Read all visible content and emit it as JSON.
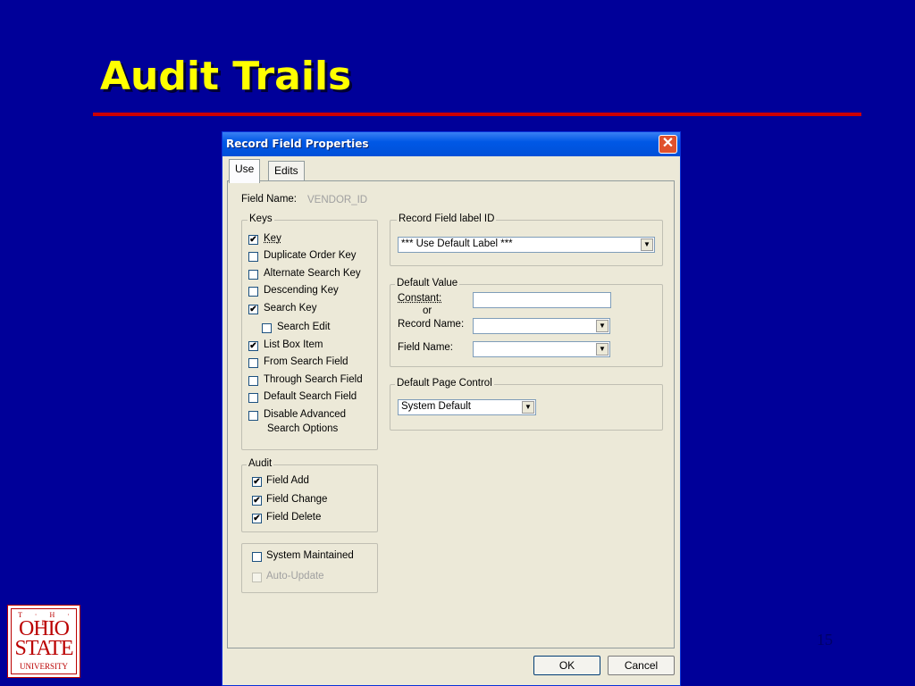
{
  "slide": {
    "title": "Audit Trails",
    "page_number": "15",
    "logo": {
      "the": "T · H · E",
      "line1": "OHIO",
      "line2": "STATE",
      "line3": "UNIVERSITY"
    }
  },
  "dialog": {
    "title": "Record Field Properties",
    "close_glyph": "✕",
    "tabs": [
      "Use",
      "Edits"
    ],
    "active_tab": "Use",
    "field_name_label": "Field Name:",
    "field_name_value": "VENDOR_ID",
    "keys": {
      "title": "Keys",
      "items": [
        {
          "label": "Key",
          "checked": true
        },
        {
          "label": "Duplicate Order Key",
          "checked": false
        },
        {
          "label": "Alternate Search Key",
          "checked": false
        },
        {
          "label": "Descending Key",
          "checked": false
        },
        {
          "label": "Search Key",
          "checked": true
        },
        {
          "label": "Search Edit",
          "checked": false
        },
        {
          "label": "List Box Item",
          "checked": true
        },
        {
          "label": "From Search Field",
          "checked": false
        },
        {
          "label": "Through Search Field",
          "checked": false
        },
        {
          "label": "Default Search Field",
          "checked": false
        },
        {
          "label": "Disable Advanced",
          "checked": false
        }
      ],
      "disable_advanced_line2": "Search Options"
    },
    "audit": {
      "title": "Audit",
      "items": [
        {
          "label": "Field Add",
          "checked": true
        },
        {
          "label": "Field Change",
          "checked": true
        },
        {
          "label": "Field Delete",
          "checked": true
        }
      ]
    },
    "system": {
      "system_maintained": "System Maintained",
      "auto_update": "Auto-Update"
    },
    "record_field_label": {
      "title": "Record Field label ID",
      "value": "*** Use Default Label ***"
    },
    "default_value": {
      "title": "Default Value",
      "constant_label": "Constant:",
      "or_label": "or",
      "record_name_label": "Record Name:",
      "field_name_label": "Field Name:"
    },
    "default_page_control": {
      "title": "Default Page Control",
      "value": "System Default"
    },
    "buttons": {
      "ok": "OK",
      "cancel": "Cancel"
    },
    "check_glyph": "✔"
  }
}
